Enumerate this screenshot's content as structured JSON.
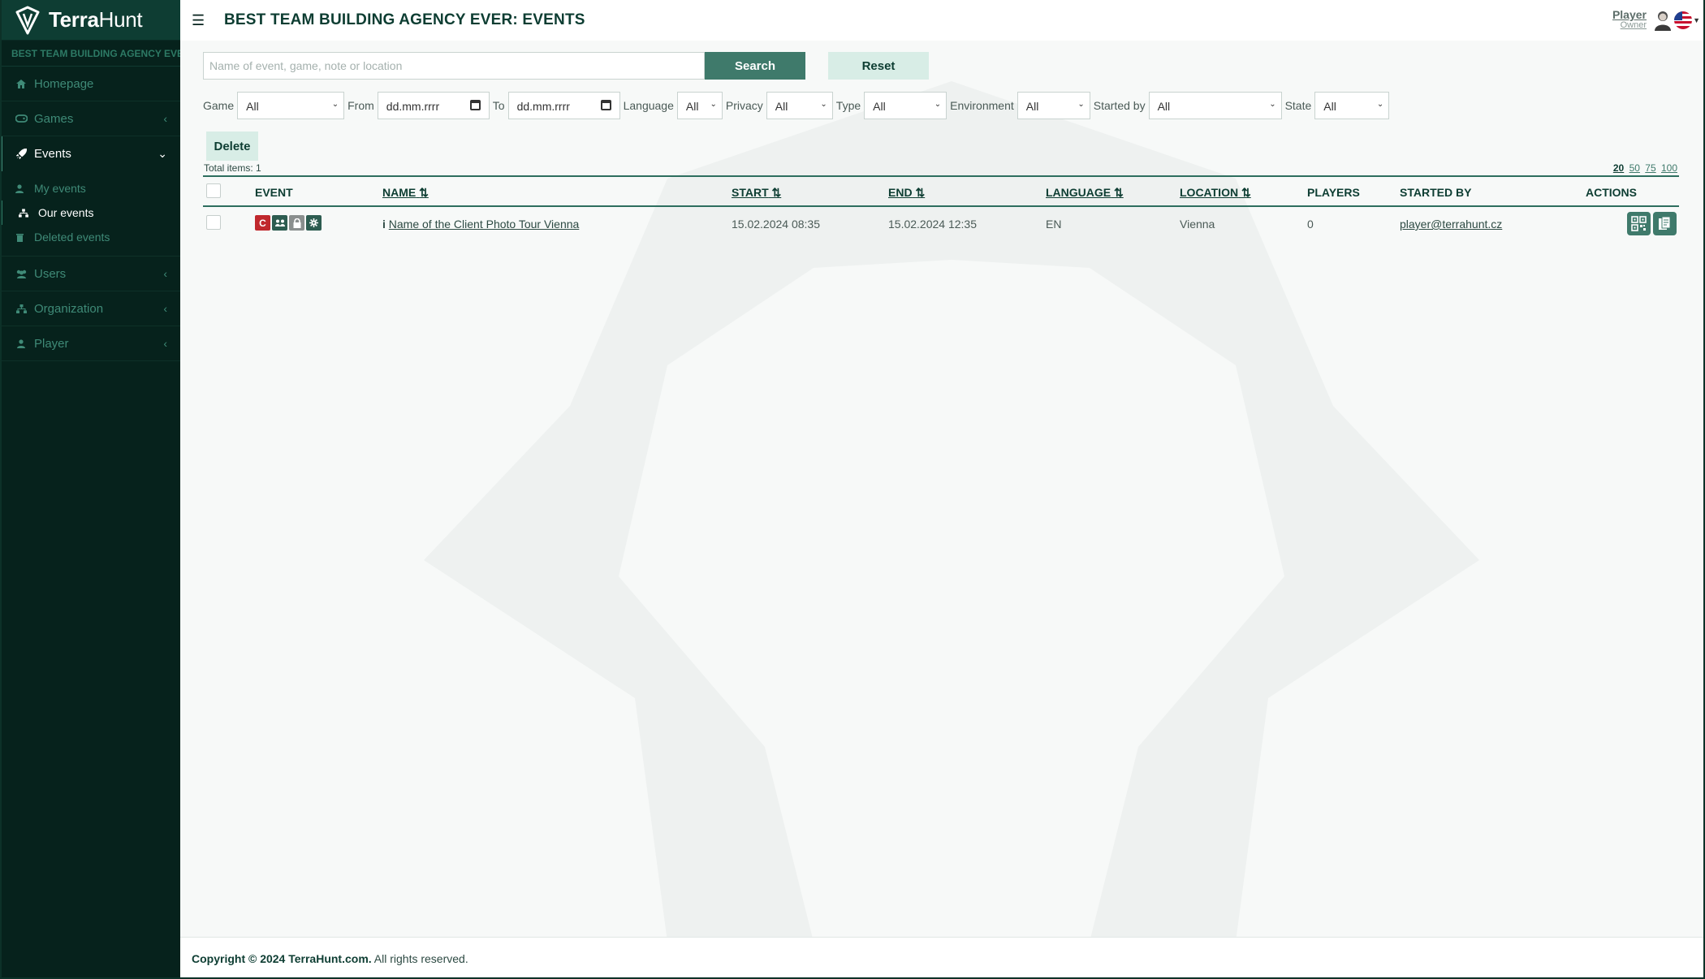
{
  "app": {
    "brand_bold": "Terra",
    "brand_light": "Hunt",
    "org_strip": "BEST TEAM BUILDING AGENCY EVER"
  },
  "header": {
    "title": "BEST TEAM BUILDING AGENCY EVER: EVENTS",
    "user_name": "Player",
    "user_role": "Owner"
  },
  "sidebar": {
    "items": [
      {
        "label": "Homepage",
        "icon": "home-icon"
      },
      {
        "label": "Games",
        "icon": "gamepad-icon"
      },
      {
        "label": "Events",
        "icon": "rocket-icon"
      },
      {
        "label": "Users",
        "icon": "users-icon"
      },
      {
        "label": "Organization",
        "icon": "sitemap-icon"
      },
      {
        "label": "Player",
        "icon": "user-icon"
      }
    ],
    "events_sub": [
      {
        "label": "My events",
        "icon": "user-icon"
      },
      {
        "label": "Our events",
        "icon": "sitemap-icon"
      },
      {
        "label": "Deleted events",
        "icon": "trash-icon"
      }
    ]
  },
  "search": {
    "placeholder": "Name of event, game, note or location",
    "search_label": "Search",
    "reset_label": "Reset"
  },
  "filters": {
    "game": {
      "label": "Game",
      "value": "All"
    },
    "from": {
      "label": "From",
      "value": "dd.mm.rrrr"
    },
    "to": {
      "label": "To",
      "value": "dd.mm.rrrr"
    },
    "language": {
      "label": "Language",
      "value": "All"
    },
    "privacy": {
      "label": "Privacy",
      "value": "All"
    },
    "type": {
      "label": "Type",
      "value": "All"
    },
    "environment": {
      "label": "Environment",
      "value": "All"
    },
    "started_by": {
      "label": "Started by",
      "value": "All"
    },
    "state": {
      "label": "State",
      "value": "All"
    }
  },
  "toolbar": {
    "delete_label": "Delete",
    "total_items": "Total items: 1",
    "page_sizes": [
      "20",
      "50",
      "75",
      "100"
    ]
  },
  "table": {
    "sort_icon": "⇅",
    "columns": {
      "event": "EVENT",
      "name": "NAME",
      "start": "START",
      "end": "END",
      "language": "LANGUAGE",
      "location": "LOCATION",
      "players": "PLAYERS",
      "started_by": "STARTED BY",
      "actions": "ACTIONS"
    },
    "rows": [
      {
        "badges": [
          "C",
          "group",
          "lock",
          "gear"
        ],
        "info": "i",
        "name": "Name of the Client Photo Tour Vienna",
        "start": "15.02.2024 08:35",
        "end": "15.02.2024 12:35",
        "language": "EN",
        "location": "Vienna",
        "players": "0",
        "started_by": "player@terrahunt.cz"
      }
    ]
  },
  "footer": {
    "copyright": "Copyright © 2024 TerraHunt.com.",
    "rights": "All rights reserved."
  },
  "colors": {
    "sidebar_bg": "#06221c",
    "brand_bg": "#0e3d33",
    "accent": "#3f7a6b",
    "badge_red": "#c0282d",
    "badge_dark": "#2d5c50",
    "badge_gray": "#8a8f8e"
  }
}
